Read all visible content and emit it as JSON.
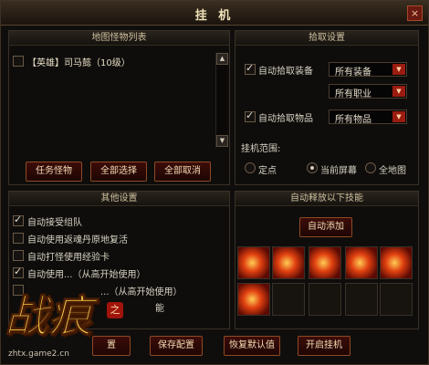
{
  "window": {
    "title": "挂 机",
    "close": "×"
  },
  "monster_panel": {
    "title": "地图怪物列表",
    "items": [
      {
        "label": "【英雄】司马懿（10级）"
      }
    ],
    "buttons": {
      "task": "任务怪物",
      "select_all": "全部选择",
      "cancel_all": "全部取消"
    }
  },
  "pickup_panel": {
    "title": "拾取设置",
    "auto_equip": {
      "label": "自动拾取装备",
      "checked": true
    },
    "equip_select": "所有装备",
    "job_select": "所有职业",
    "auto_items": {
      "label": "自动拾取物品",
      "checked": true
    },
    "items_select": "所有物品",
    "range_label": "挂机范围:",
    "ranges": [
      {
        "label": "定点",
        "selected": false
      },
      {
        "label": "当前屏幕",
        "selected": true
      },
      {
        "label": "全地图",
        "selected": false
      }
    ]
  },
  "other_panel": {
    "title": "其他设置",
    "options": [
      {
        "label": "自动接受组队",
        "checked": true
      },
      {
        "label": "自动使用返魂丹原地复活",
        "checked": false
      },
      {
        "label": "自动打怪使用经验卡",
        "checked": false
      },
      {
        "label": "自动使用...（从高开始使用）",
        "checked": true
      },
      {
        "label": "...（从高开始使用）",
        "checked": false
      },
      {
        "label": "能",
        "checked": false
      }
    ]
  },
  "skill_panel": {
    "title": "自动释放以下技能",
    "add_button": "自动添加",
    "skills_filled": 6,
    "slots_total": 10
  },
  "bottom_buttons": {
    "a": "置",
    "save": "保存配置",
    "restore": "恢复默认值",
    "start": "开启挂机"
  },
  "logo": {
    "text": "战痕",
    "url": "zhtx.game2.cn",
    "seal": "之"
  }
}
